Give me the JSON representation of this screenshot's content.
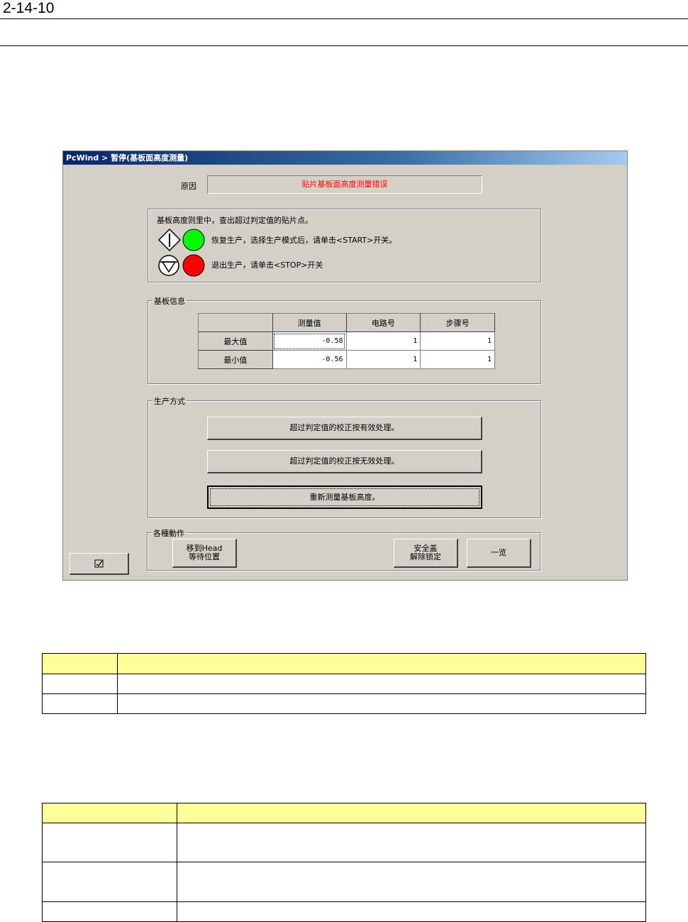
{
  "page": {
    "number": "2-14-10"
  },
  "window": {
    "title": "PcWind > 暂停(基板面高度测量)",
    "reason_label": "原因",
    "reason_value": "贴片基板面高度测量错误",
    "colors": {
      "reason_text": "#ff0000",
      "start_lamp": "#00ff00",
      "stop_lamp": "#ff0000"
    }
  },
  "message": {
    "line1": "基板高度则里中，查出超过判定值的贴片点。",
    "line2": "恢复生产，选择生产模式后，请单击<START>开关。",
    "line3": "退出生产，请单击<STOP>开关",
    "start_icon": "start-diamond-icon",
    "stop_icon": "stop-circle-icon"
  },
  "board_info": {
    "title": "基板信息",
    "columns": [
      "",
      "测量值",
      "电路号",
      "步骤号"
    ],
    "rows": [
      {
        "label": "最大值",
        "measure": "-0.58",
        "circuit": "1",
        "step": "1"
      },
      {
        "label": "最小值",
        "measure": "-0.56",
        "circuit": "1",
        "step": "1"
      }
    ]
  },
  "production_mode": {
    "title": "生产方式",
    "btn1": "超过判定值的校正按有效处理。",
    "btn2": "超过判定值的校正按无效处理。",
    "btn3": "重新测量基板高度。"
  },
  "actions": {
    "title": "各種動作",
    "move_line1": "移到Head",
    "move_line2": "等待位置",
    "safety_line1": "安全盖",
    "safety_line2": "解除锁定",
    "list": "一览",
    "left_icon": "checkbox-icon"
  }
}
